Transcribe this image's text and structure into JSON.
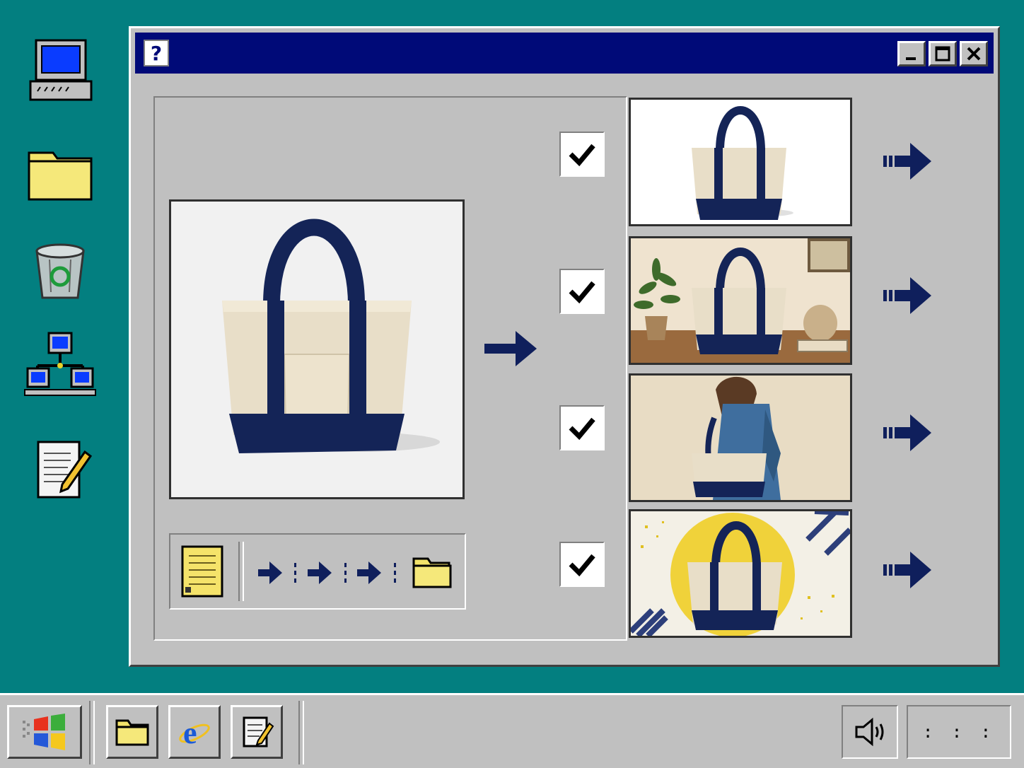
{
  "desktop": {
    "icons": [
      {
        "name": "my-computer-icon"
      },
      {
        "name": "folder-icon"
      },
      {
        "name": "recycle-bin-icon"
      },
      {
        "name": "network-icon"
      },
      {
        "name": "notepad-icon"
      }
    ]
  },
  "window": {
    "title_icon_glyph": "?",
    "title_color": "#000a78",
    "controls": [
      "minimize-icon",
      "maximize-icon",
      "close-icon"
    ],
    "main_image": {
      "subject": "tote-bag"
    },
    "pipeline": {
      "steps": [
        "document-icon",
        "arrow",
        "arrow",
        "arrow",
        "folder-icon"
      ]
    },
    "outputs": [
      {
        "scene": "white-background",
        "checked": true
      },
      {
        "scene": "lifestyle-shelf",
        "checked": true
      },
      {
        "scene": "worn-by-model",
        "checked": true
      },
      {
        "scene": "graphic-yellow-circle",
        "checked": true
      }
    ]
  },
  "taskbar": {
    "start_icon": "windows-logo-icon",
    "quick_launch": [
      "folder-icon",
      "browser-icon",
      "notepad-icon"
    ],
    "tray": {
      "volume_icon": "speaker-icon",
      "clock": ": : :"
    }
  },
  "colors": {
    "desktop": "#037f80",
    "navy": "#0f1f5c",
    "canvas": "#efe5cf",
    "window": "#c0c0c0"
  }
}
